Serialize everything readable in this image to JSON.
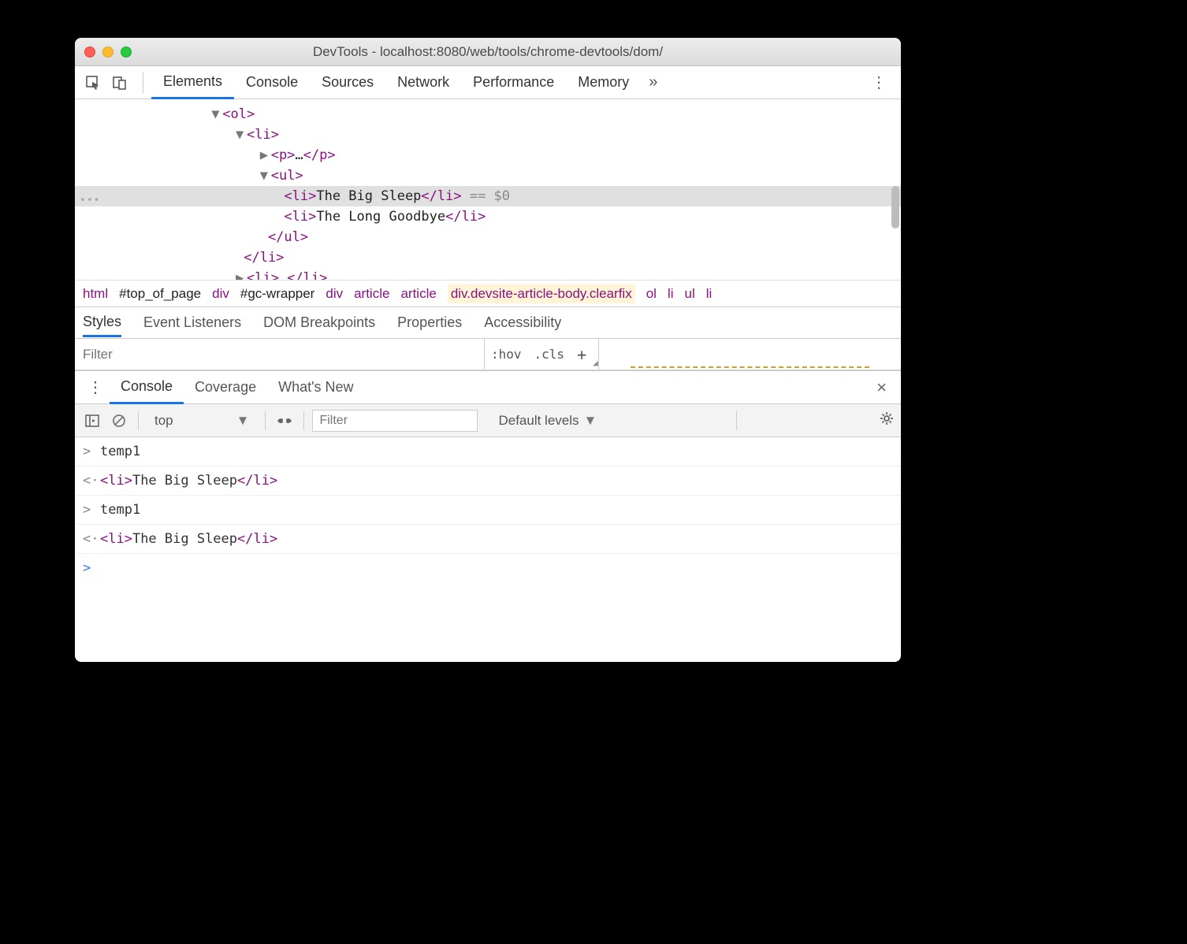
{
  "window": {
    "title": "DevTools - localhost:8080/web/tools/chrome-devtools/dom/"
  },
  "main_tabs": [
    "Elements",
    "Console",
    "Sources",
    "Network",
    "Performance",
    "Memory"
  ],
  "main_tabs_active": 0,
  "dom": {
    "lines": [
      {
        "indent": 128,
        "tri": "▼",
        "open": "<ol>",
        "sel": false
      },
      {
        "indent": 152,
        "tri": "▼",
        "open": "<li>",
        "sel": false
      },
      {
        "indent": 176,
        "tri": "▶",
        "open": "<p>",
        "mid": "…",
        "close": "</p>",
        "sel": false
      },
      {
        "indent": 176,
        "tri": "▼",
        "open": "<ul>",
        "sel": false
      },
      {
        "indent": 204,
        "open": "<li>",
        "text": "The Big Sleep",
        "close": "</li>",
        "suffix": " == $0",
        "sel": true
      },
      {
        "indent": 204,
        "open": "<li>",
        "text": "The Long Goodbye",
        "close": "</li>",
        "sel": false
      },
      {
        "indent": 190,
        "close_only": "</ul>",
        "sel": false
      },
      {
        "indent": 166,
        "close_only": "</li>",
        "sel": false
      },
      {
        "indent": 152,
        "tri": "▶",
        "open": "<li>",
        "mid": "…",
        "close": "</li>",
        "sel": false
      }
    ]
  },
  "breadcrumb": [
    {
      "label": "html",
      "cls": "bc"
    },
    {
      "label": "#top_of_page",
      "cls": "bc idsel"
    },
    {
      "label": "div",
      "cls": "bc"
    },
    {
      "label": "#gc-wrapper",
      "cls": "bc idsel"
    },
    {
      "label": "div",
      "cls": "bc"
    },
    {
      "label": "article",
      "cls": "bc"
    },
    {
      "label": "article",
      "cls": "bc"
    },
    {
      "label": "div.devsite-article-body.clearfix",
      "cls": "bc hl"
    },
    {
      "label": "ol",
      "cls": "bc"
    },
    {
      "label": "li",
      "cls": "bc"
    },
    {
      "label": "ul",
      "cls": "bc"
    },
    {
      "label": "li",
      "cls": "bc"
    }
  ],
  "styles_tabs": [
    "Styles",
    "Event Listeners",
    "DOM Breakpoints",
    "Properties",
    "Accessibility"
  ],
  "styles_tabs_active": 0,
  "filter": {
    "placeholder": "Filter",
    "hov": ":hov",
    "cls": ".cls"
  },
  "drawer_tabs": [
    "Console",
    "Coverage",
    "What's New"
  ],
  "drawer_tabs_active": 0,
  "console_toolbar": {
    "context": "top",
    "filter_placeholder": "Filter",
    "levels": "Default levels"
  },
  "console_rows": [
    {
      "icon": ">",
      "text": "temp1",
      "html": false
    },
    {
      "icon": "<·",
      "text": "The Big Sleep",
      "html": true
    },
    {
      "icon": ">",
      "text": "temp1",
      "html": false
    },
    {
      "icon": "<·",
      "text": "The Big Sleep",
      "html": true
    }
  ],
  "console_prompt": ">"
}
